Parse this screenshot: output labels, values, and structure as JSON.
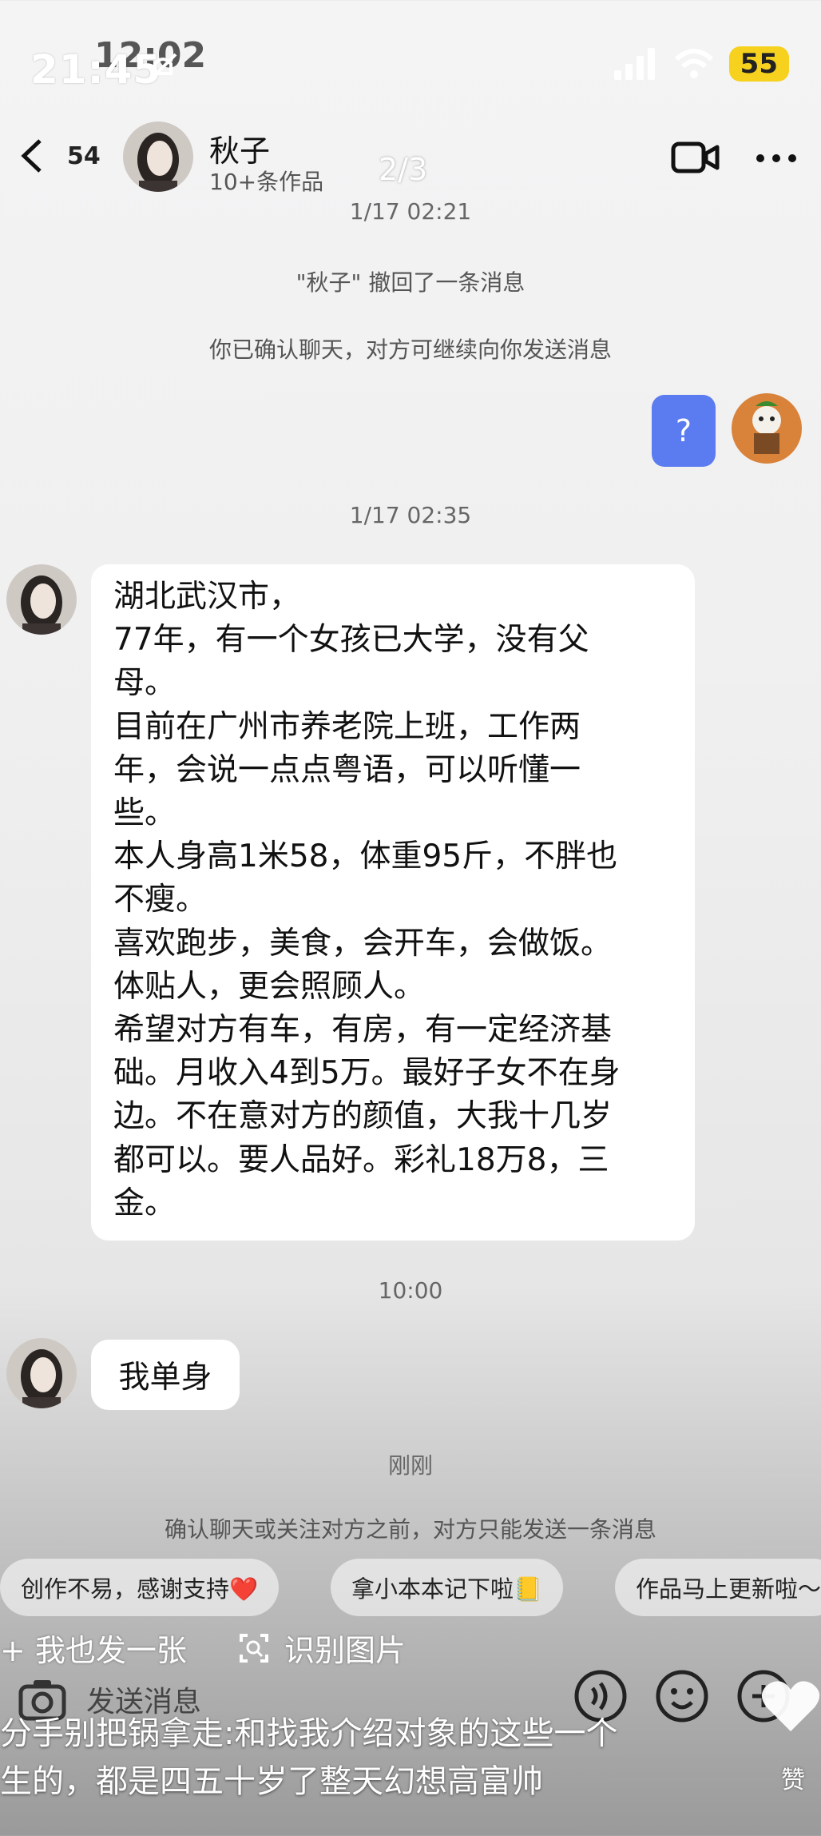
{
  "status_bar": {
    "time": "21:45",
    "time_ghost": "12:02",
    "battery": "55"
  },
  "header": {
    "unread_count": "54",
    "contact_name": "秋子",
    "contact_sub": "10+条作品",
    "page_indicator": "2/3"
  },
  "chat": {
    "timestamp_1": "1/17 02:21",
    "recall_notice": "\"秋子\" 撤回了一条消息",
    "confirm_notice": "你已确认聊天，对方可继续向你发送消息",
    "my_message": "?",
    "timestamp_2": "1/17 02:35",
    "long_message_lines": [
      "湖北武汉市，",
      "77年，有一个女孩已大学，没有父",
      "母。",
      "目前在广州市养老院上班，工作两",
      "年，会说一点点粤语，可以听懂一",
      "些。",
      "本人身高1米58，体重95斤，不胖也",
      "不瘦。",
      "喜欢跑步，美食，会开车，会做饭。",
      "体贴人，更会照顾人。",
      "希望对方有车，有房，有一定经济基",
      "础。月收入4到5万。最好子女不在身",
      "边。不在意对方的颜值，大我十几岁",
      "都可以。要人品好。彩礼18万8，三",
      "金。"
    ],
    "timestamp_3": "10:00",
    "short_message": "我单身",
    "timestamp_4": "刚刚",
    "limit_notice": "确认聊天或关注对方之前，对方只能发送一条消息"
  },
  "quick_replies": [
    "创作不易，感谢支持❤️",
    "拿小本本记下啦📒",
    "作品马上更新啦～"
  ],
  "actions": {
    "post_too": "我也发一张",
    "recognize_image": "识别图片",
    "send_placeholder": "发送消息"
  },
  "caption": {
    "line1": "分手别把锅拿走:和找我介绍对象的这些一个",
    "line2": "生的，都是四五十岁了整天幻想高富帅"
  },
  "like_label": "赞",
  "colors": {
    "accent_blue": "#5b7cf0",
    "battery_yellow": "#f6d11d"
  }
}
